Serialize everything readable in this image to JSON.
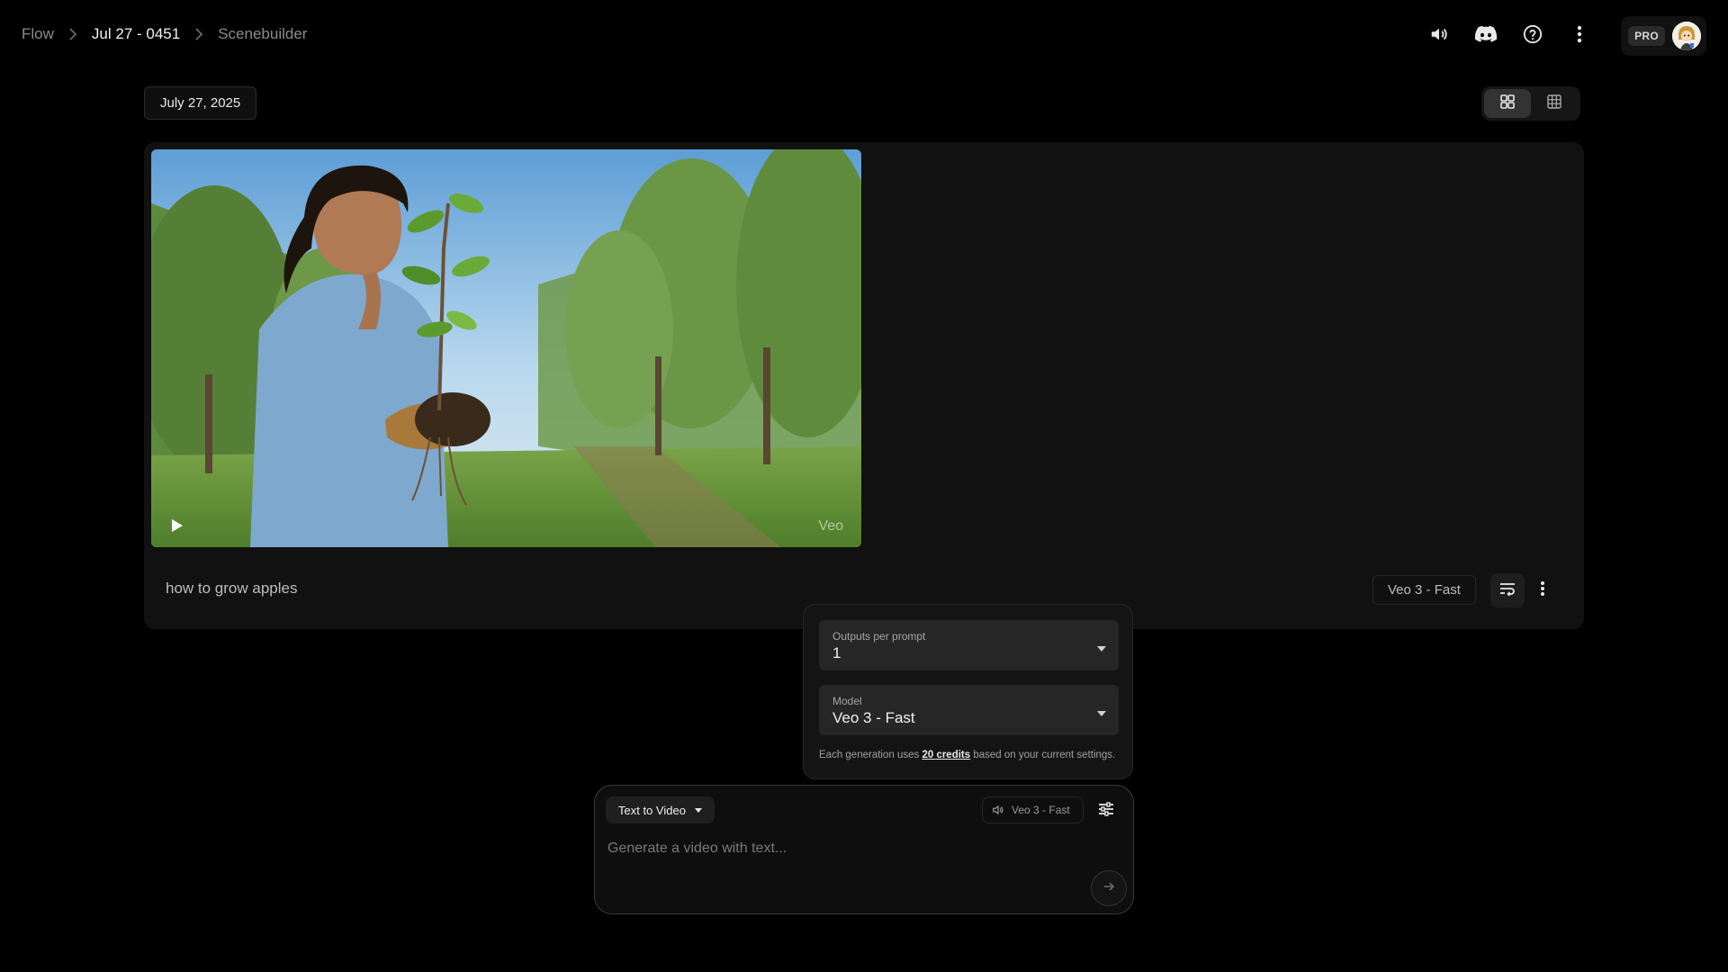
{
  "breadcrumb": {
    "root": "Flow",
    "project": "Jul 27 - 0451",
    "page": "Scenebuilder"
  },
  "topbar": {
    "icons": [
      "volume-icon",
      "discord-icon",
      "help-icon",
      "more-vert-icon"
    ],
    "plan_badge": "PRO"
  },
  "date_chip": "July 27, 2025",
  "view_toggle": {
    "options": [
      "grid-large-icon",
      "grid-small-icon"
    ],
    "selected": "grid-large-icon"
  },
  "card": {
    "video_watermark": "Veo",
    "prompt": "how to grow apples",
    "model_chip": "Veo 3 - Fast"
  },
  "settings": {
    "outputs_label": "Outputs per prompt",
    "outputs_value": "1",
    "model_label": "Model",
    "model_value": "Veo 3 - Fast",
    "credits_prefix": "Each generation uses ",
    "credits_link": "20 credits",
    "credits_suffix": " based on your current settings."
  },
  "composer": {
    "mode": "Text to Video",
    "model_chip": "Veo 3 - Fast",
    "placeholder": "Generate a video with text..."
  },
  "colors": {
    "background": "#000000",
    "card": "#111111",
    "accent_text": "#f2f2f2"
  }
}
